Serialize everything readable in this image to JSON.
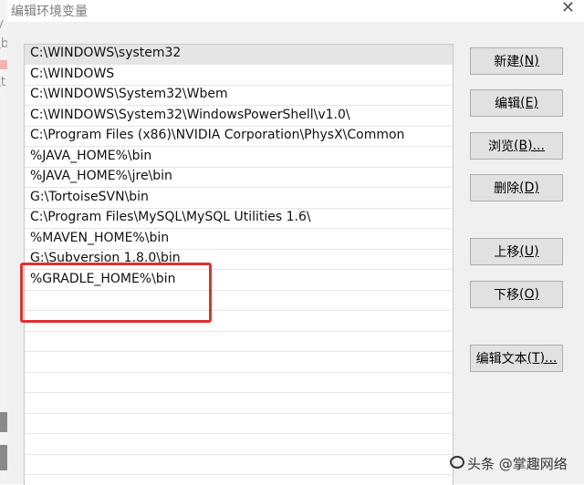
{
  "window": {
    "title": "编辑环境变量",
    "close_glyph": "✕"
  },
  "background_window": {
    "fragments": [
      "y",
      "\\b",
      "\\t"
    ]
  },
  "path_list": {
    "items": [
      "C:\\WINDOWS\\system32",
      "C:\\WINDOWS",
      "C:\\WINDOWS\\System32\\Wbem",
      "C:\\WINDOWS\\System32\\WindowsPowerShell\\v1.0\\",
      "C:\\Program Files (x86)\\NVIDIA Corporation\\PhysX\\Common",
      "%JAVA_HOME%\\bin",
      "%JAVA_HOME%\\jre\\bin",
      "G:\\TortoiseSVN\\bin",
      "C:\\Program Files\\MySQL\\MySQL Utilities 1.6\\",
      "%MAVEN_HOME%\\bin",
      "G:\\Subversion 1.8.0\\bin",
      "%GRADLE_HOME%\\bin"
    ],
    "selected_index": 0,
    "highlighted_item": "%GRADLE_HOME%\\bin",
    "highlight_color": "#e03030"
  },
  "buttons": {
    "new": {
      "label": "新建",
      "accel": "(N)"
    },
    "edit": {
      "label": "编辑",
      "accel": "(E)"
    },
    "browse": {
      "label": "浏览",
      "accel": "(B)..."
    },
    "delete": {
      "label": "删除",
      "accel": "(D)"
    },
    "move_up": {
      "label": "上移",
      "accel": "(U)"
    },
    "move_down": {
      "label": "下移",
      "accel": "(O)"
    },
    "edit_text": {
      "label": "编辑文本",
      "accel": "(T)..."
    }
  },
  "watermark": {
    "text": "头条 @掌趣网络"
  }
}
